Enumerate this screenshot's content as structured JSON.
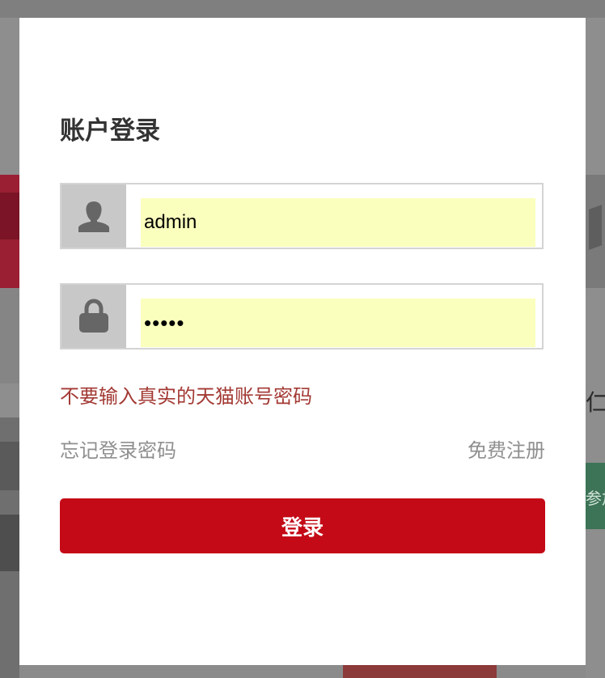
{
  "login": {
    "title": "账户登录",
    "username": {
      "value": "admin",
      "icon": "user-icon"
    },
    "password": {
      "value": "•••••",
      "icon": "lock-icon"
    },
    "warning": "不要输入真实的天猫账号密码",
    "forgot_link": "忘记登录密码",
    "register_link": "免费注册",
    "submit_label": "登录"
  },
  "background": {
    "right_partial_char": "仁",
    "right_green_partial": "参加"
  },
  "colors": {
    "overlay": "#8e8e8e",
    "accent": "#c40a16",
    "warning": "#a33a34",
    "autofill": "#faffbd",
    "link": "#8f8f8f"
  }
}
